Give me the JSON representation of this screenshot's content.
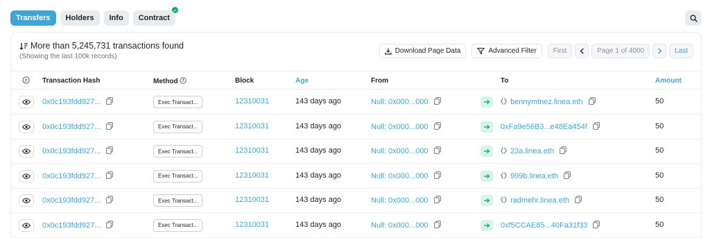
{
  "tabs": [
    {
      "label": "Transfers",
      "active": true
    },
    {
      "label": "Holders"
    },
    {
      "label": "Info"
    },
    {
      "label": "Contract",
      "verified": true
    }
  ],
  "summary": {
    "count_text": "More than 5,245,731 transactions found",
    "sub_text": "(Showing the last 100k records)"
  },
  "toolbar": {
    "download_label": "Download Page Data",
    "filter_label": "Advanced Filter",
    "first_label": "First",
    "page_label": "Page 1 of 4000",
    "last_label": "Last"
  },
  "columns": {
    "hash": "Transaction Hash",
    "method": "Method",
    "block": "Block",
    "age": "Age",
    "from": "From",
    "to": "To",
    "amount": "Amount"
  },
  "rows": [
    {
      "hash": "0x0c193fdd927...",
      "method": "Exec Transact...",
      "block": "12310031",
      "age": "143 days ago",
      "from": "Null: 0x000...000",
      "to": "bennymtnez.linea.eth",
      "to_ens": true,
      "amount": "50"
    },
    {
      "hash": "0x0c193fdd927...",
      "method": "Exec Transact...",
      "block": "12310031",
      "age": "143 days ago",
      "from": "Null: 0x000...000",
      "to": "0xFa9e56B3...e48Ea454f",
      "to_ens": false,
      "amount": "50"
    },
    {
      "hash": "0x0c193fdd927...",
      "method": "Exec Transact...",
      "block": "12310031",
      "age": "143 days ago",
      "from": "Null: 0x000...000",
      "to": "23a.linea.eth",
      "to_ens": true,
      "amount": "50"
    },
    {
      "hash": "0x0c193fdd927...",
      "method": "Exec Transact...",
      "block": "12310031",
      "age": "143 days ago",
      "from": "Null: 0x000...000",
      "to": "999b.linea.eth",
      "to_ens": true,
      "amount": "50"
    },
    {
      "hash": "0x0c193fdd927...",
      "method": "Exec Transact...",
      "block": "12310031",
      "age": "143 days ago",
      "from": "Null: 0x000...000",
      "to": "radmehr.linea.eth",
      "to_ens": true,
      "amount": "50"
    },
    {
      "hash": "0x0c193fdd927...",
      "method": "Exec Transact...",
      "block": "12310031",
      "age": "143 days ago",
      "from": "Null: 0x000...000",
      "to": "0xf5CCAE85...40Fa31f33",
      "to_ens": false,
      "amount": "50"
    }
  ],
  "colors": {
    "accent": "#3ea6d6",
    "verified": "#12a578",
    "arrow_bg": "#d7f3ea"
  }
}
